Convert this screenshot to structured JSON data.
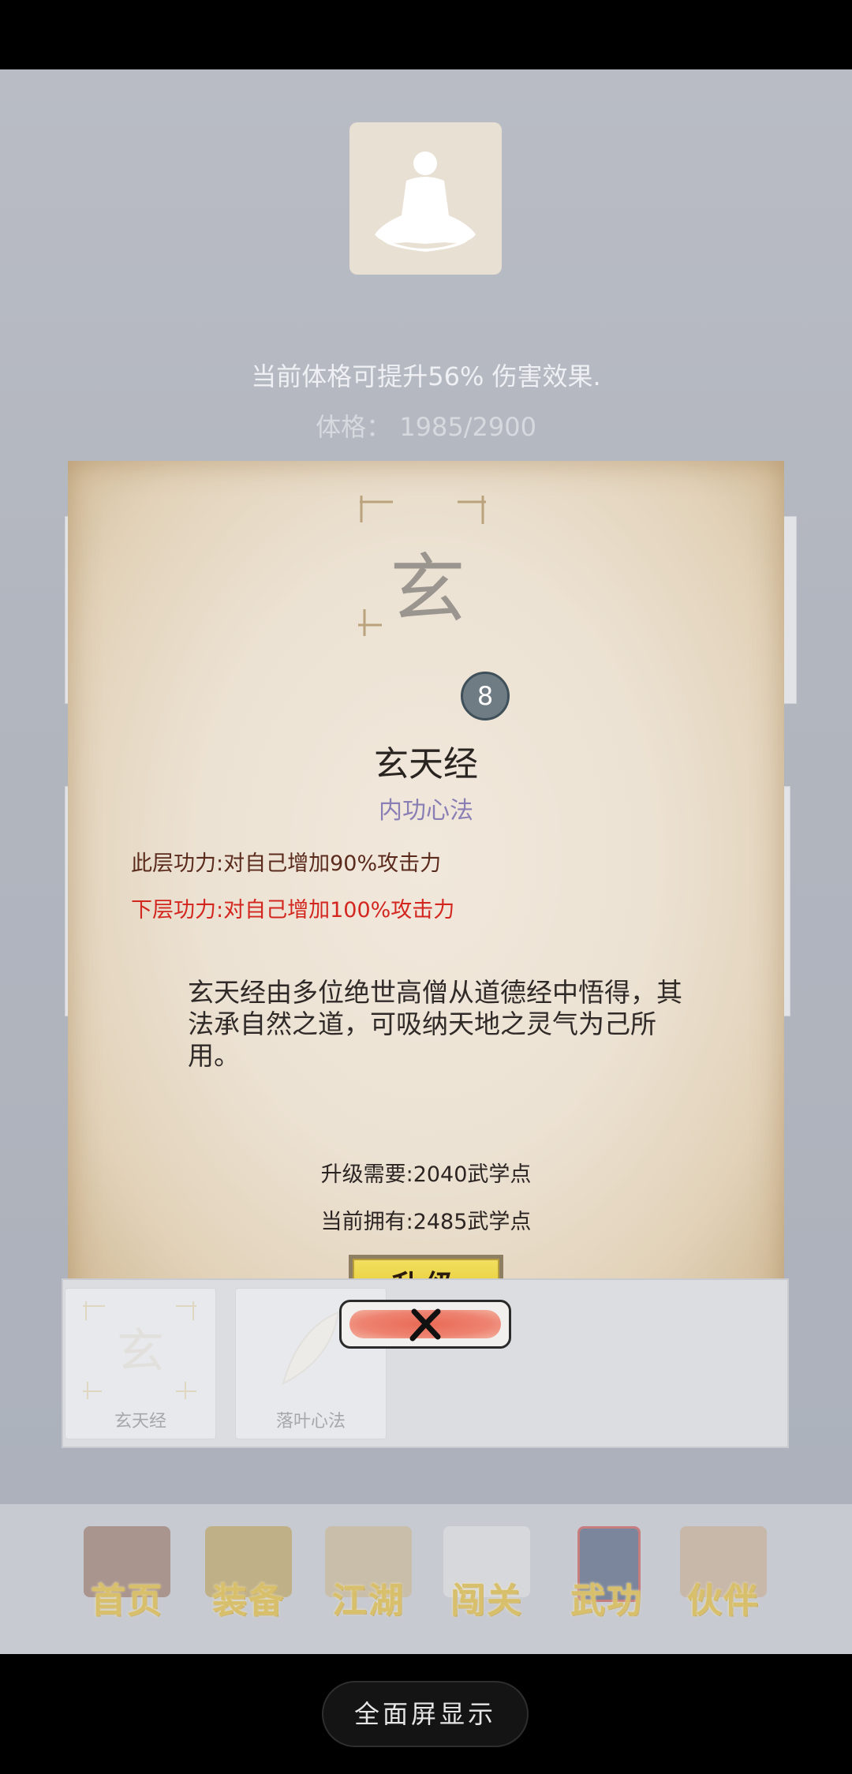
{
  "header": {
    "bonus_text": "当前体格可提升56% 伤害效果.",
    "stat_label": "体格：",
    "stat_value": "1985/2900"
  },
  "skill": {
    "icon_glyph": "玄",
    "level": "8",
    "name": "玄天经",
    "type": "内功心法",
    "current_layer": "此层功力:对自己增加90%攻击力",
    "next_layer": "下层功力:对自己增加100%攻击力",
    "description": "玄天经由多位绝世高僧从道德经中悟得，其法承自然之道，可吸纳天地之灵气为己所用。",
    "upgrade_cost": "升级需要:2040武学点",
    "current_points": "当前拥有:2485武学点",
    "upgrade_label": "升级"
  },
  "list": {
    "items": [
      {
        "label": "玄天经",
        "icon": "xuan-glyph-icon"
      },
      {
        "label": "落叶心法",
        "icon": "leaf-icon"
      }
    ]
  },
  "close_label": "✕",
  "nav": {
    "items": [
      {
        "label": "首页",
        "icon": "house-icon"
      },
      {
        "label": "装备",
        "icon": "armor-icon"
      },
      {
        "label": "江湖",
        "icon": "scroll-map-icon"
      },
      {
        "label": "闯关",
        "icon": "crossed-swords-icon"
      },
      {
        "label": "武功",
        "icon": "book-icon"
      },
      {
        "label": "伙伴",
        "icon": "companions-icon"
      }
    ]
  },
  "system": {
    "fullscreen_label": "全面屏显示"
  },
  "colors": {
    "accent_purple": "#8a7fb5",
    "next_layer_red": "#d3261f",
    "upgrade_yellow": "#e9cf3e",
    "nav_gold": "#d8bf6c"
  }
}
